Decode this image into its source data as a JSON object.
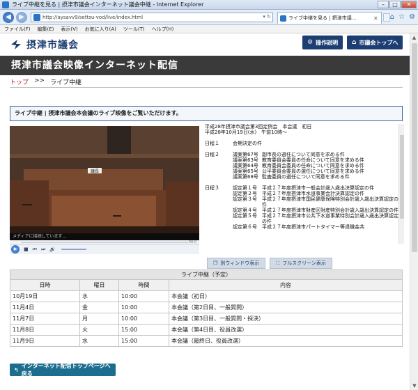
{
  "browser": {
    "title": "ライブ中継を見る | 摂津市議会インターネット議会中継 - Internet Explorer",
    "url": "http://aysavv9/settsu-vod/live/index.html",
    "tab_title": "ライブ中継を見る | 摂津市議...",
    "menu": [
      "ファイル(F)",
      "編集(E)",
      "表示(V)",
      "お気に入り(A)",
      "ツール(T)",
      "ヘルプ(H)"
    ]
  },
  "site": {
    "logo_text": "摂津市議会",
    "help_button": "操作説明",
    "top_button": "市議会トップへ",
    "banner_title": "摂津市議会映像インターネット配信",
    "breadcrumb_home": "トップ",
    "breadcrumb_sep": ">>",
    "breadcrumb_current": "ライブ中継",
    "notice": "ライブ中継 | 摂津市議会本会議のライブ映像をご覧いただけます。"
  },
  "player": {
    "status": "メディアに接続しています...",
    "time_end": "00:0",
    "nameplate": "議長"
  },
  "agenda": {
    "line1": "平成28年摂津市議会第3回定例会　本会議　初日",
    "line2": "平成28年10月19日(水)　午前10時～",
    "days": [
      {
        "label": "日程１",
        "items": [
          {
            "no": "",
            "text": "会期決定の件"
          }
        ]
      },
      {
        "label": "日程２",
        "items": [
          {
            "no": "議案第67号",
            "text": "副市長の選任について同意を求める件"
          },
          {
            "no": "議案第63号",
            "text": "教育委員会委員の任命について同意を求める件"
          },
          {
            "no": "議案第64号",
            "text": "教育委員会委員の任命について同意を求める件"
          },
          {
            "no": "議案第65号",
            "text": "公平委員会委員の選任について同意を求める件"
          },
          {
            "no": "議案第68号",
            "text": "監査委員の選任について同意を求める件"
          }
        ]
      },
      {
        "label": "日程３",
        "items": [
          {
            "no": "認定第１号",
            "text": "平成２７年度摂津市一般会計歳入歳出決算認定の件"
          },
          {
            "no": "認定第２号",
            "text": "平成２７年度摂津市水道事業会計決算認定の件"
          },
          {
            "no": "認定第３号",
            "text": "平成２７年度摂津市国民健康保険特別会計歳入歳出決算認定の件"
          },
          {
            "no": "認定第４号",
            "text": "平成２７年度摂津市財産区財産特別会計歳入歳出決算認定の件"
          },
          {
            "no": "認定第５号",
            "text": "平成２７年度摂津市公共下水道事業特別会計歳入歳出決算認定の件"
          },
          {
            "no": "認定第６号",
            "text": "平成２７年度摂津市パートタイマー等退職金共"
          }
        ]
      }
    ]
  },
  "view_buttons": {
    "separate": "別ウィンドウ表示",
    "fullscreen": "フルスクリーン表示"
  },
  "schedule": {
    "caption": "ライブ中継（予定）",
    "headers": [
      "日時",
      "曜日",
      "時間",
      "内容"
    ],
    "rows": [
      [
        "10月19日",
        "水",
        "10:00",
        "本会議（初日）"
      ],
      [
        "11月4日",
        "金",
        "10:00",
        "本会議（第2日目、一般質問）"
      ],
      [
        "11月7日",
        "月",
        "10:00",
        "本会議（第3日目、一般質問・採決）"
      ],
      [
        "11月8日",
        "火",
        "15:00",
        "本会議（第4日目、役員改選）"
      ],
      [
        "11月9日",
        "水",
        "15:00",
        "本会議（最終日、役員改選）"
      ]
    ]
  },
  "back_button": "インターネット配信トップページへ戻る"
}
